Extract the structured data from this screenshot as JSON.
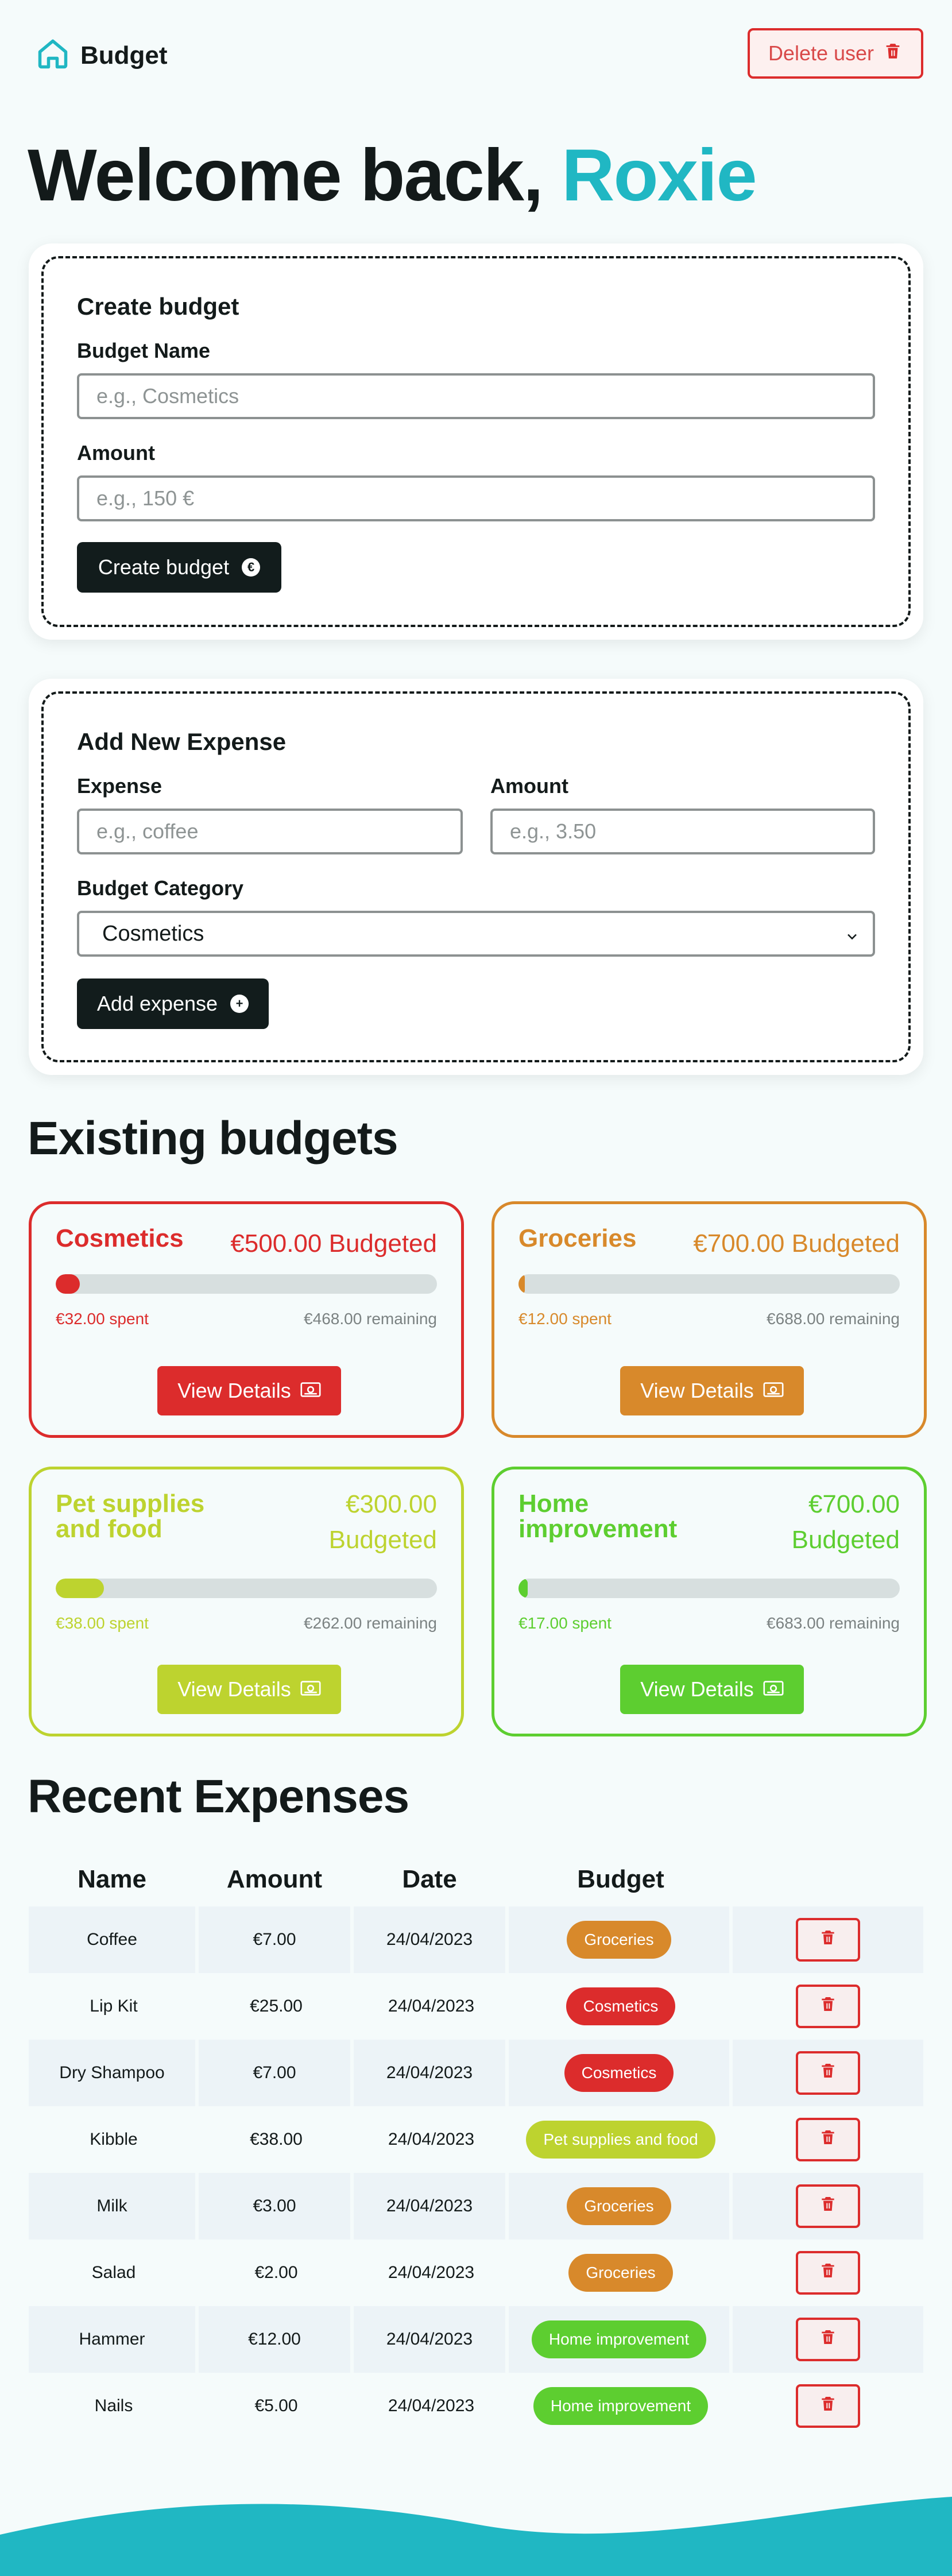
{
  "nav": {
    "brand": "Budget",
    "delete_user": "Delete user"
  },
  "welcome": {
    "prefix": "Welcome back,",
    "name": "Roxie"
  },
  "create_budget": {
    "title": "Create budget",
    "name_label": "Budget Name",
    "name_placeholder": "e.g., Cosmetics",
    "amount_label": "Amount",
    "amount_placeholder": "e.g., 150 €",
    "submit_label": "Create budget",
    "submit_icon": "€"
  },
  "add_expense": {
    "title": "Add New Expense",
    "expense_label": "Expense",
    "expense_placeholder": "e.g., coffee",
    "amount_label": "Amount",
    "amount_placeholder": "e.g., 3.50",
    "category_label": "Budget Category",
    "category_selected": "Cosmetics",
    "submit_label": "Add expense",
    "submit_icon": "+"
  },
  "existing_budgets": {
    "title": "Existing budgets",
    "view_label": "View Details",
    "items": [
      {
        "name": "Cosmetics",
        "budgeted": "€500.00 Budgeted",
        "spent": "€32.00 spent",
        "remaining": "€468.00 remaining",
        "progress": 0.064,
        "color": "#dc2c2c"
      },
      {
        "name": "Groceries",
        "budgeted": "€700.00 Budgeted",
        "spent": "€12.00 spent",
        "remaining": "€688.00 remaining",
        "progress": 0.017,
        "color": "#d8892b"
      },
      {
        "name": "Pet supplies and food",
        "budgeted": "€300.00 Budgeted",
        "spent": "€38.00 spent",
        "remaining": "€262.00 remaining",
        "progress": 0.127,
        "color": "#bdd32f"
      },
      {
        "name": "Home improvement",
        "budgeted": "€700.00 Budgeted",
        "spent": "€17.00 spent",
        "remaining": "€683.00 remaining",
        "progress": 0.024,
        "color": "#5dce30"
      }
    ]
  },
  "recent_expenses": {
    "title": "Recent Expenses",
    "headers": [
      "Name",
      "Amount",
      "Date",
      "Budget"
    ],
    "rows": [
      {
        "name": "Coffee",
        "amount": "€7.00",
        "date": "24/04/2023",
        "budget": "Groceries",
        "color": "#d8892b"
      },
      {
        "name": "Lip Kit",
        "amount": "€25.00",
        "date": "24/04/2023",
        "budget": "Cosmetics",
        "color": "#dc2c2c"
      },
      {
        "name": "Dry Shampoo",
        "amount": "€7.00",
        "date": "24/04/2023",
        "budget": "Cosmetics",
        "color": "#dc2c2c"
      },
      {
        "name": "Kibble",
        "amount": "€38.00",
        "date": "24/04/2023",
        "budget": "Pet supplies and food",
        "color": "#bdd32f"
      },
      {
        "name": "Milk",
        "amount": "€3.00",
        "date": "24/04/2023",
        "budget": "Groceries",
        "color": "#d8892b"
      },
      {
        "name": "Salad",
        "amount": "€2.00",
        "date": "24/04/2023",
        "budget": "Groceries",
        "color": "#d8892b"
      },
      {
        "name": "Hammer",
        "amount": "€12.00",
        "date": "24/04/2023",
        "budget": "Home improvement",
        "color": "#5dce30"
      },
      {
        "name": "Nails",
        "amount": "€5.00",
        "date": "24/04/2023",
        "budget": "Home improvement",
        "color": "#5dce30"
      }
    ]
  },
  "colors": {
    "accent": "#20b7c3",
    "danger": "#dc2c2c",
    "dark": "#121c1c"
  }
}
